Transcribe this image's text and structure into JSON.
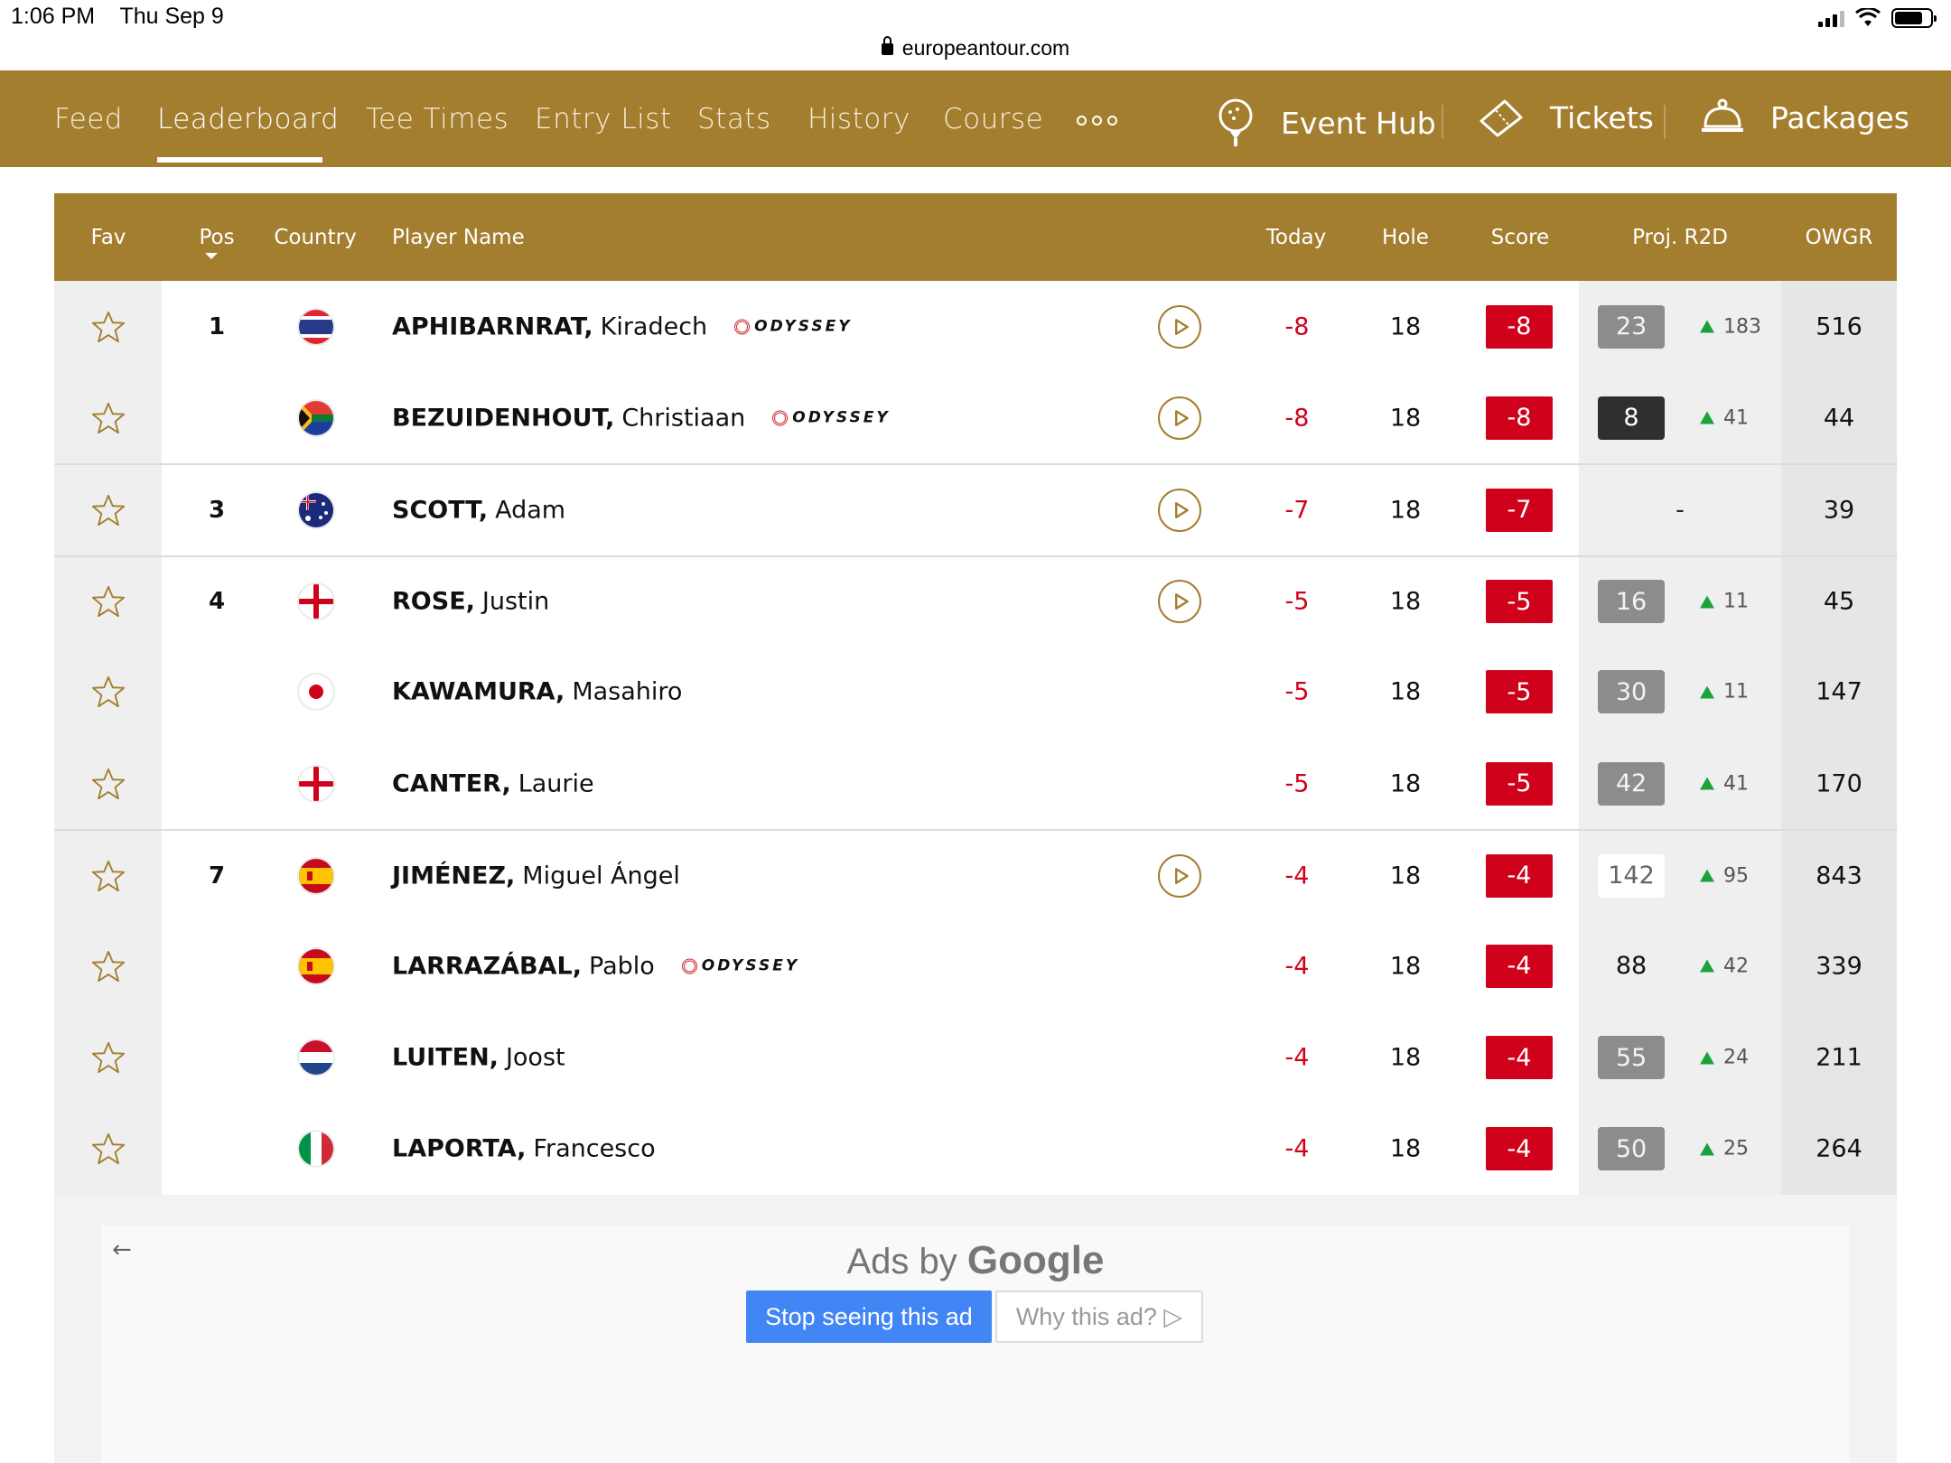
{
  "status": {
    "time": "1:06 PM",
    "date": "Thu Sep 9",
    "url": "europeantour.com"
  },
  "nav": {
    "items": [
      "Feed",
      "Leaderboard",
      "Tee Times",
      "Entry List",
      "Stats",
      "History",
      "Course"
    ],
    "active": "Leaderboard",
    "event_hub": "Event Hub",
    "tickets": "Tickets",
    "packages": "Packages",
    "accent": "#a47e2f"
  },
  "table": {
    "headers": {
      "fav": "Fav",
      "pos": "Pos",
      "country": "Country",
      "player": "Player Name",
      "today": "Today",
      "hole": "Hole",
      "score": "Score",
      "proj": "Proj. R2D",
      "owgr": "OWGR"
    },
    "rows": [
      {
        "pos": "1",
        "country": "Thailand",
        "last": "APHIBARNRAT,",
        "first": "Kiradech",
        "sponsor": "ODYSSEY",
        "video": true,
        "today": "-8",
        "hole": "18",
        "score": "-8",
        "proj": "23",
        "proj_style": "grey",
        "move": "183",
        "owgr": "516",
        "sep": false
      },
      {
        "pos": "",
        "country": "South Africa",
        "last": "BEZUIDENHOUT,",
        "first": "Christiaan",
        "sponsor": "ODYSSEY",
        "video": true,
        "today": "-8",
        "hole": "18",
        "score": "-8",
        "proj": "8",
        "proj_style": "black",
        "move": "41",
        "owgr": "44",
        "sep": false
      },
      {
        "pos": "3",
        "country": "Australia",
        "last": "SCOTT,",
        "first": "Adam",
        "sponsor": "",
        "video": true,
        "today": "-7",
        "hole": "18",
        "score": "-7",
        "proj": "-",
        "proj_style": "dash",
        "move": "",
        "owgr": "39",
        "sep": true
      },
      {
        "pos": "4",
        "country": "England",
        "last": "ROSE,",
        "first": "Justin",
        "sponsor": "",
        "video": true,
        "today": "-5",
        "hole": "18",
        "score": "-5",
        "proj": "16",
        "proj_style": "grey",
        "move": "11",
        "owgr": "45",
        "sep": true
      },
      {
        "pos": "",
        "country": "Japan",
        "last": "KAWAMURA,",
        "first": "Masahiro",
        "sponsor": "",
        "video": false,
        "today": "-5",
        "hole": "18",
        "score": "-5",
        "proj": "30",
        "proj_style": "grey",
        "move": "11",
        "owgr": "147",
        "sep": false
      },
      {
        "pos": "",
        "country": "England",
        "last": "CANTER,",
        "first": "Laurie",
        "sponsor": "",
        "video": false,
        "today": "-5",
        "hole": "18",
        "score": "-5",
        "proj": "42",
        "proj_style": "grey",
        "move": "41",
        "owgr": "170",
        "sep": false
      },
      {
        "pos": "7",
        "country": "Spain",
        "last": "JIMÉNEZ,",
        "first": "Miguel Ángel",
        "sponsor": "",
        "video": true,
        "today": "-4",
        "hole": "18",
        "score": "-4",
        "proj": "142",
        "proj_style": "white",
        "move": "95",
        "owgr": "843",
        "sep": true
      },
      {
        "pos": "",
        "country": "Spain",
        "last": "LARRAZÁBAL,",
        "first": "Pablo",
        "sponsor": "ODYSSEY",
        "video": false,
        "today": "-4",
        "hole": "18",
        "score": "-4",
        "proj": "88",
        "proj_style": "plain",
        "move": "42",
        "owgr": "339",
        "sep": false
      },
      {
        "pos": "",
        "country": "Netherlands",
        "last": "LUITEN,",
        "first": "Joost",
        "sponsor": "",
        "video": false,
        "today": "-4",
        "hole": "18",
        "score": "-4",
        "proj": "55",
        "proj_style": "grey",
        "move": "24",
        "owgr": "211",
        "sep": false
      },
      {
        "pos": "",
        "country": "Italy",
        "last": "LAPORTA,",
        "first": "Francesco",
        "sponsor": "",
        "video": false,
        "today": "-4",
        "hole": "18",
        "score": "-4",
        "proj": "50",
        "proj_style": "grey",
        "move": "25",
        "owgr": "264",
        "sep": false
      }
    ]
  },
  "ad": {
    "ads_by": "Ads by",
    "google": "Google",
    "stop": "Stop seeing this ad",
    "why": "Why this ad?"
  }
}
